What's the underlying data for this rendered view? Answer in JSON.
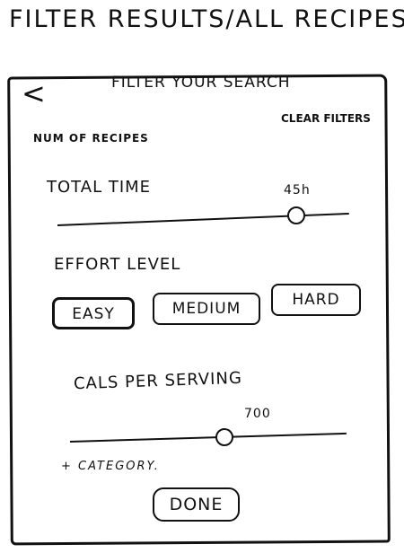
{
  "page": {
    "title": "Filter Results/All Recipes"
  },
  "header": {
    "back_label": "<",
    "title": "Filter your search"
  },
  "summary": {
    "num_recipes_label": "Num of recipes",
    "clear_filters_label": "Clear filters"
  },
  "total_time": {
    "label": "Total time",
    "value": "45h",
    "slider_level": 0.82
  },
  "effort_level": {
    "label": "Effort level",
    "options": [
      "Easy",
      "Medium",
      "Hard"
    ],
    "selected": "Easy"
  },
  "cals_per_serving": {
    "label": "Cals per serving",
    "value": "700",
    "slider_level": 0.56
  },
  "category": {
    "label": "+ Category."
  },
  "done": {
    "label": "Done"
  },
  "colors": {
    "ink": "#111111",
    "paper": "#ffffff"
  }
}
